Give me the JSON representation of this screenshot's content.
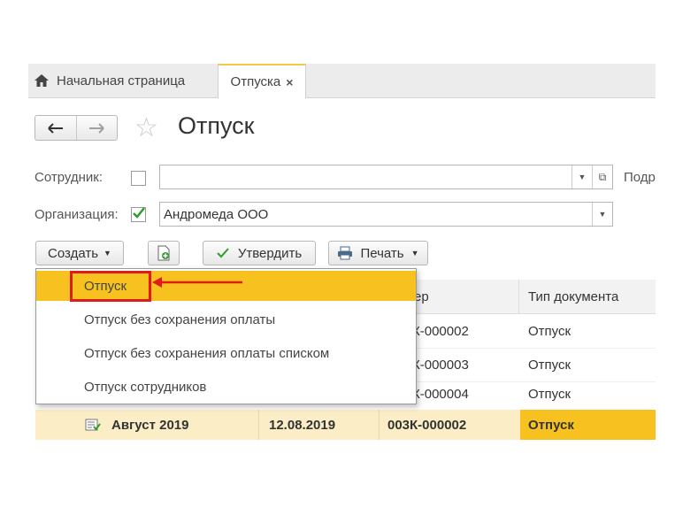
{
  "tabs": {
    "home_label": "Начальная страница",
    "active_label": "Отпуска",
    "close_glyph": "×"
  },
  "header": {
    "title": "Отпуск"
  },
  "form": {
    "employee_label": "Сотрудник:",
    "employee_value": "",
    "employee_checked": false,
    "subdivision_label_partial": "Подр",
    "organization_label": "Организация:",
    "organization_value": "Андромеда ООО",
    "organization_checked": true
  },
  "toolbar": {
    "create_label": "Создать",
    "approve_label": "Утвердить",
    "print_label": "Печать"
  },
  "create_menu": {
    "items": [
      "Отпуск",
      "Отпуск без сохранения оплаты",
      "Отпуск без сохранения оплаты списком",
      "Отпуск сотрудников"
    ],
    "highlighted_index": 0
  },
  "grid": {
    "headers": {
      "number_partial": "ер",
      "doc_type": "Тип документа"
    },
    "rows": [
      {
        "number_partial": "К-000002",
        "doc_type": "Отпуск"
      },
      {
        "number_partial": "К-000003",
        "doc_type": "Отпуск"
      },
      {
        "number_partial": "К-000004",
        "doc_type": "Отпуск"
      }
    ],
    "selected_row": {
      "period": "Август 2019",
      "date": "12.08.2019",
      "number": "003К-000002",
      "doc_type": "Отпуск"
    }
  },
  "colors": {
    "accent_yellow": "#f7c21f",
    "selected_row_bg": "#fbedc6",
    "highlight_red": "#e01b1b",
    "check_green": "#2e9e2e"
  }
}
